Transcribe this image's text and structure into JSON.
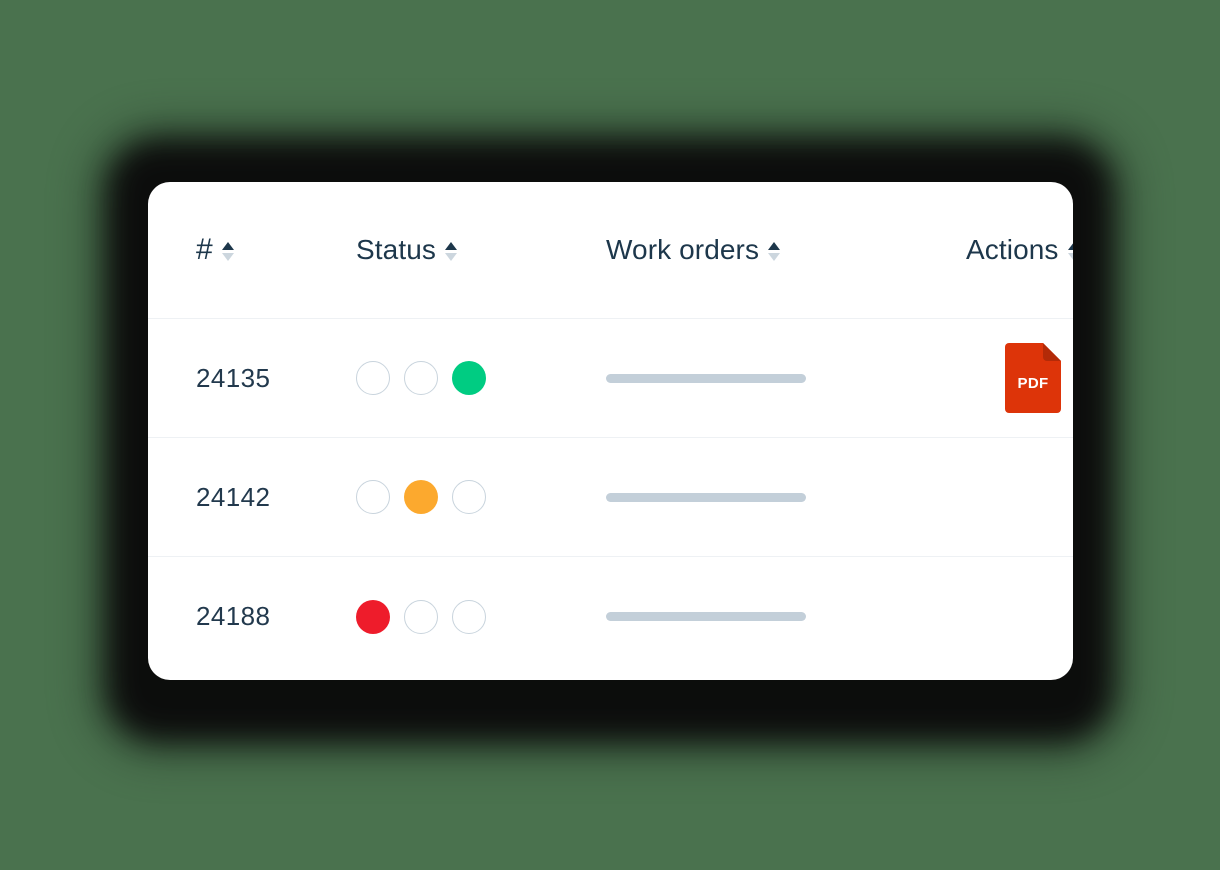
{
  "theme": {
    "background_color": "#4a724e",
    "card_color": "#ffffff",
    "divider_color": "#eef1f4",
    "text_color": "#22394d",
    "placeholder_bar_color": "#c3cfd9",
    "dot_empty_border_color": "#c9d4dd",
    "sort_active_color": "#1d374b",
    "sort_inactive_color": "#ccd6de"
  },
  "table": {
    "columns": [
      {
        "key": "id",
        "label": "#",
        "sort_icon": "sort-arrows-icon"
      },
      {
        "key": "status",
        "label": "Status",
        "sort_icon": "sort-arrows-icon"
      },
      {
        "key": "work_orders",
        "label": "Work orders",
        "sort_icon": "sort-arrows-icon"
      },
      {
        "key": "actions",
        "label": "Actions",
        "sort_icon": "sort-arrows-icon"
      }
    ],
    "rows": [
      {
        "id": "24135",
        "status_dots": [
          {
            "state": "empty",
            "color": "#ffffff"
          },
          {
            "state": "empty",
            "color": "#ffffff"
          },
          {
            "state": "filled",
            "color": "#00cc82"
          }
        ],
        "work_orders_placeholder": true,
        "action": {
          "icon": "pdf-file-icon",
          "label": "PDF",
          "color": "#dd3409",
          "fold_color": "#b32a08"
        }
      },
      {
        "id": "24142",
        "status_dots": [
          {
            "state": "empty",
            "color": "#ffffff"
          },
          {
            "state": "filled",
            "color": "#fca92e"
          },
          {
            "state": "empty",
            "color": "#ffffff"
          }
        ],
        "work_orders_placeholder": true,
        "action": null
      },
      {
        "id": "24188",
        "status_dots": [
          {
            "state": "filled",
            "color": "#ee1c2b"
          },
          {
            "state": "empty",
            "color": "#ffffff"
          },
          {
            "state": "empty",
            "color": "#ffffff"
          }
        ],
        "work_orders_placeholder": true,
        "action": null
      }
    ]
  }
}
